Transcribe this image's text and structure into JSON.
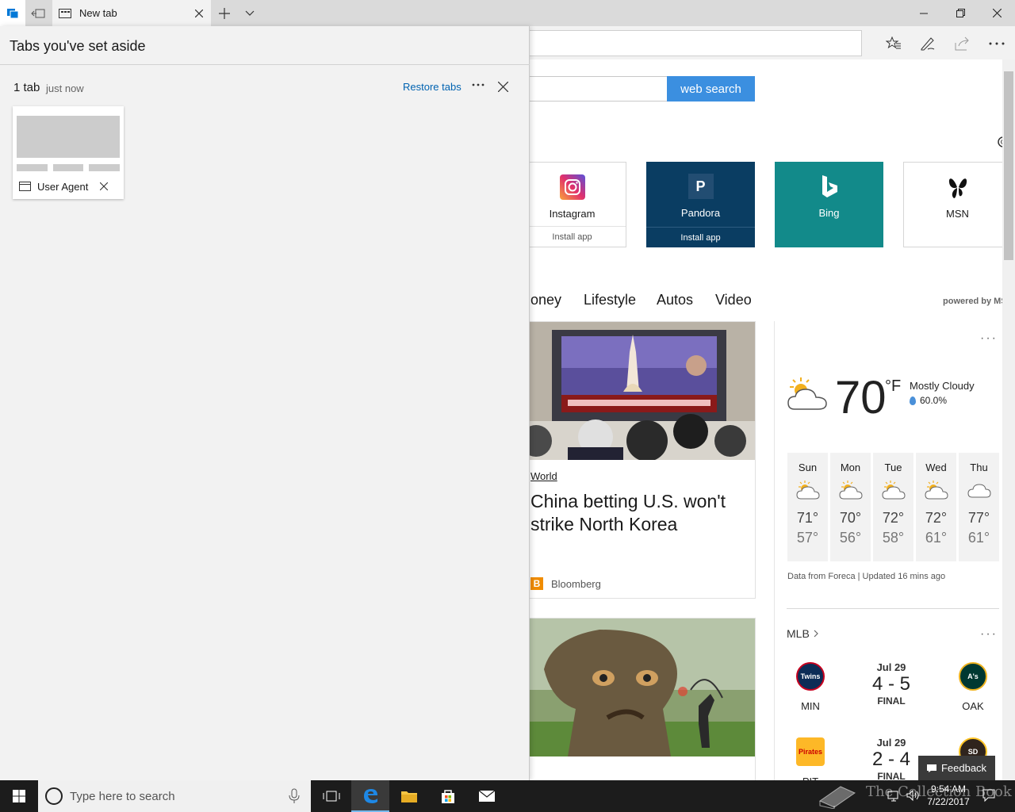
{
  "browser": {
    "tab_title": "New tab",
    "search_button": "web search"
  },
  "panel": {
    "title": "Tabs you've set aside",
    "group_count": "1 tab",
    "group_time": "just now",
    "restore_label": "Restore tabs",
    "tab_label": "User Agent"
  },
  "tiles": [
    {
      "name": "Instagram",
      "action": "Install app"
    },
    {
      "name": "Pandora",
      "action": "Install app",
      "logo_letter": "P"
    },
    {
      "name": "Bing"
    },
    {
      "name": "MSN"
    }
  ],
  "news_nav": [
    "oney",
    "Lifestyle",
    "Autos",
    "Video"
  ],
  "powered_by": "powered by MS",
  "articles": [
    {
      "category": "World",
      "title": "China betting U.S. won't strike North Korea",
      "source": "Bloomberg",
      "source_logo": "B"
    }
  ],
  "weather": {
    "temp": "70",
    "unit": "°F",
    "condition": "Mostly Cloudy",
    "precip": "60.0%",
    "days": [
      {
        "name": "Sun",
        "hi": "71°",
        "lo": "57°",
        "icon": "partly-sunny"
      },
      {
        "name": "Mon",
        "hi": "70°",
        "lo": "56°",
        "icon": "partly-sunny"
      },
      {
        "name": "Tue",
        "hi": "72°",
        "lo": "58°",
        "icon": "partly-sunny"
      },
      {
        "name": "Wed",
        "hi": "72°",
        "lo": "61°",
        "icon": "partly-sunny"
      },
      {
        "name": "Thu",
        "hi": "77°",
        "lo": "61°",
        "icon": "cloudy"
      }
    ],
    "footer": "Data from Foreca | Updated 16 mins ago"
  },
  "mlb": {
    "title": "MLB",
    "games": [
      {
        "date": "Jul 29",
        "score": "4 - 5",
        "status": "FINAL",
        "home": "MIN",
        "away": "OAK",
        "home_logo": "Twins",
        "away_logo": "A's"
      },
      {
        "date": "Jul 29",
        "score": "2 - 4",
        "status": "FINAL",
        "home": "PIT",
        "away": "",
        "home_logo": "Pirates",
        "away_logo": "SD"
      }
    ]
  },
  "feedback": "Feedback",
  "taskbar": {
    "search_placeholder": "Type here to search",
    "time": "9:54 AM",
    "date": "7/22/2017"
  },
  "watermark": "The Collection Book",
  "colors": {
    "accent": "#3b8fe0",
    "pandora": "#0a3d62",
    "bing": "#128a8a",
    "link": "#0063b1"
  }
}
